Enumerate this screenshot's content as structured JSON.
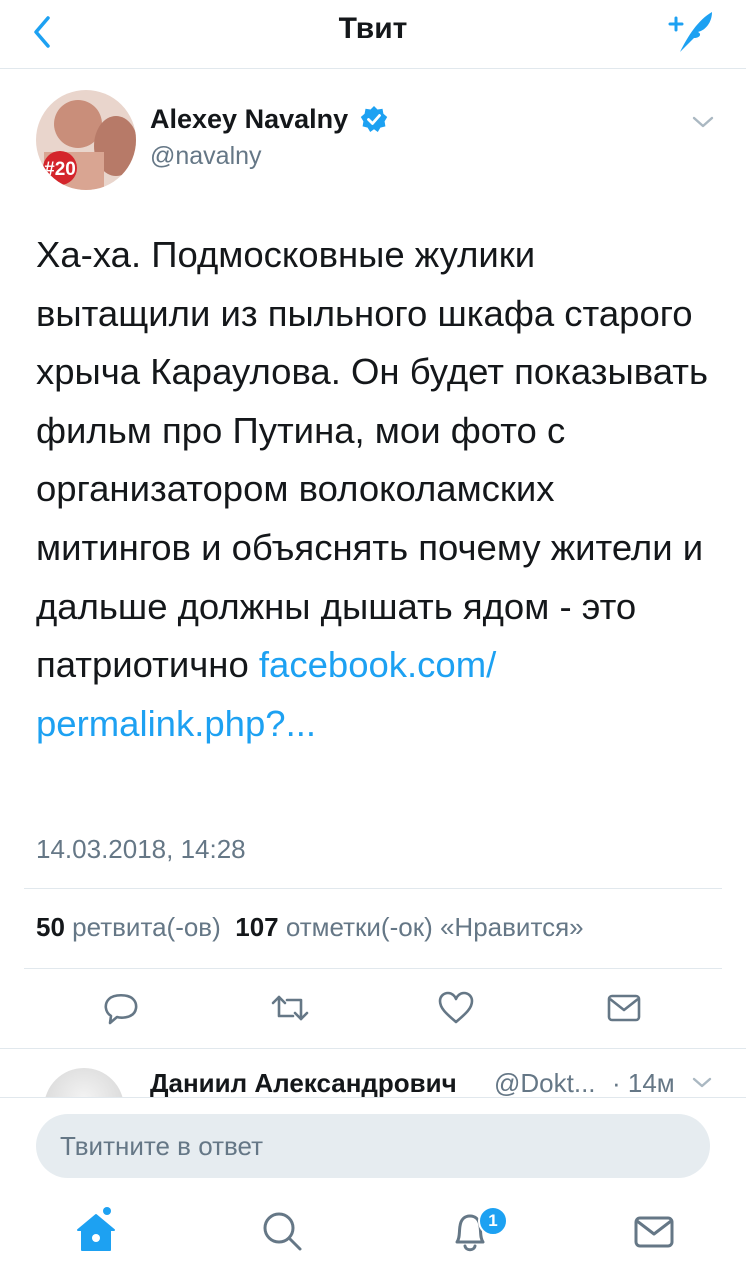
{
  "header": {
    "title": "Твит",
    "back_icon": "chevron-left-icon",
    "compose_icon": "compose-tweet-icon"
  },
  "tweet": {
    "author_name": "Alexey Navalny",
    "author_handle": "@navalny",
    "avatar_badge": "#20",
    "verified": true,
    "text": "Ха-ха. Подмосковные жулики вытащили из пыльного шкафа старого хрыча Караулова. Он будет показывать фильм про Путина, мои фото с организатором волоколамских митингов и объяснять почему жители и дальше должны дышать ядом - это патриотично",
    "link_text": "facebook.com/ permalink.php?...",
    "timestamp": "14.03.2018, 14:28",
    "retweet_count": "50",
    "retweet_label": "ретвита(-ов)",
    "like_count": "107",
    "like_label": "отметки(-ок) «Нравится»"
  },
  "actions": [
    "reply-icon",
    "retweet-icon",
    "like-icon",
    "share-icon"
  ],
  "reply_preview": {
    "name": "Даниил Александрович",
    "handle": "@Dokt...",
    "time": "· 14м"
  },
  "composer": {
    "placeholder": "Твитните в ответ"
  },
  "tab_bar": {
    "items": [
      "home-icon",
      "search-icon",
      "notifications-icon",
      "messages-icon"
    ],
    "notification_count": "1"
  },
  "colors": {
    "accent": "#1da1f2",
    "text": "#14171a",
    "secondary": "#657786",
    "border": "#e1e8ed",
    "input_bg": "#e6ecf0"
  }
}
